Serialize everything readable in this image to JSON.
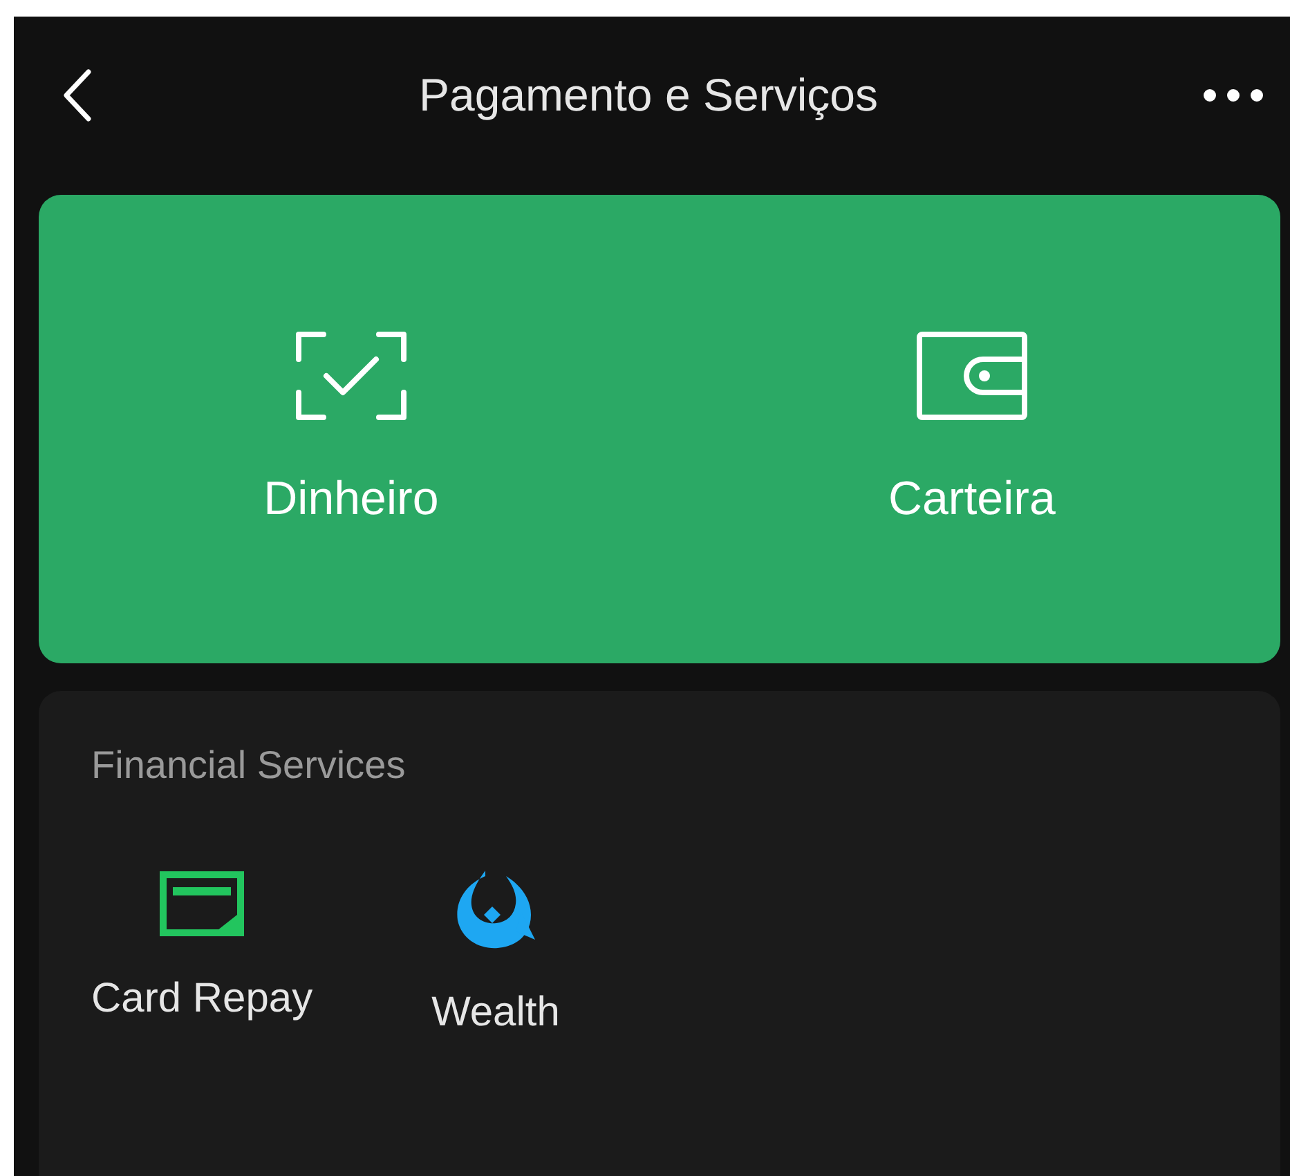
{
  "header": {
    "title": "Pagamento e Serviços"
  },
  "quick_actions": [
    {
      "kind": "scan",
      "label": "Dinheiro"
    },
    {
      "kind": "wallet",
      "label": "Carteira"
    }
  ],
  "financial_services": {
    "title": "Financial Services",
    "items": [
      {
        "kind": "card",
        "label": "Card Repay"
      },
      {
        "kind": "wealth",
        "label": "Wealth"
      }
    ]
  }
}
